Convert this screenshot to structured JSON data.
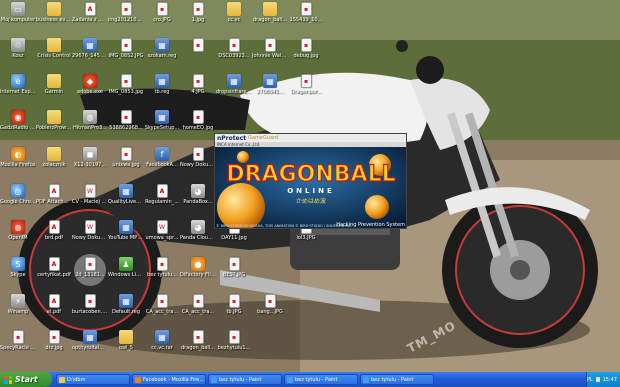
{
  "desktop": {
    "icons": [
      {
        "label": "Mój komputer",
        "kind": "gray",
        "glyph": "▭"
      },
      {
        "label": "business everywhere",
        "kind": "folder",
        "glyph": ""
      },
      {
        "label": "Zadania z matematyki",
        "kind": "pdf",
        "glyph": "A"
      },
      {
        "label": "img20121006...",
        "kind": "file",
        "glyph": "▪"
      },
      {
        "label": "cro.JPG",
        "kind": "file",
        "glyph": "▪"
      },
      {
        "label": "1.jpg",
        "kind": "file",
        "glyph": "▪"
      },
      {
        "label": "cc.vc",
        "kind": "folder",
        "glyph": ""
      },
      {
        "label": "dragon_ball...",
        "kind": "folder",
        "glyph": ""
      },
      {
        "label": "155439_10...",
        "kind": "file",
        "glyph": "▪"
      },
      {
        "label": "Kosz",
        "kind": "gray",
        "glyph": "♲"
      },
      {
        "label": "Crisis Control",
        "kind": "folder",
        "glyph": ""
      },
      {
        "label": "29676_14585...",
        "kind": "exe",
        "glyph": "▦"
      },
      {
        "label": "IMG_0852.JPG",
        "kind": "file",
        "glyph": "▪"
      },
      {
        "label": "szokam.reg",
        "kind": "exe",
        "glyph": "▦"
      },
      {
        "label": "",
        "kind": "file",
        "glyph": "▪"
      },
      {
        "label": "DSC03923...",
        "kind": "file",
        "glyph": "▪"
      },
      {
        "label": "Johnnie Walker office",
        "kind": "file",
        "glyph": "▪"
      },
      {
        "label": "debug.jpg",
        "kind": "file",
        "glyph": "▪"
      },
      {
        "label": "Internet Explorer",
        "kind": "globe",
        "glyph": "e"
      },
      {
        "label": "Garmin",
        "kind": "folder",
        "glyph": ""
      },
      {
        "label": "adobe.exe",
        "kind": "red",
        "glyph": "◆"
      },
      {
        "label": "IMG_0853.jpg",
        "kind": "file",
        "glyph": "▪"
      },
      {
        "label": "tb.reg",
        "kind": "exe",
        "glyph": "▦"
      },
      {
        "label": "4.JPG",
        "kind": "file",
        "glyph": "▪"
      },
      {
        "label": "dropsinfrared...",
        "kind": "exe",
        "glyph": "▦"
      },
      {
        "label": "2706041...",
        "kind": "exe",
        "glyph": "▦"
      },
      {
        "label": "Dragonpor...",
        "kind": "file",
        "glyph": "▪"
      },
      {
        "label": "GadziRadio 10",
        "kind": "red",
        "glyph": "◉"
      },
      {
        "label": "PobierzProwa...",
        "kind": "folder",
        "glyph": ""
      },
      {
        "label": "HitmanPro3...",
        "kind": "gray",
        "glyph": "◍"
      },
      {
        "label": "538862968...",
        "kind": "file",
        "glyph": "▪"
      },
      {
        "label": "SkypeSetup...",
        "kind": "exe",
        "glyph": "▦"
      },
      {
        "label": "homeEQ.jpg",
        "kind": "file",
        "glyph": "▪"
      },
      {
        "label": "Mozilla Firefox",
        "kind": "orange",
        "glyph": "◐"
      },
      {
        "label": "zolacznik",
        "kind": "folder",
        "glyph": ""
      },
      {
        "label": "X12-30197...",
        "kind": "gray",
        "glyph": "◼"
      },
      {
        "label": "unixwa.jpg",
        "kind": "file",
        "glyph": "▪"
      },
      {
        "label": "FacebookA...",
        "kind": "exe",
        "glyph": "f"
      },
      {
        "label": "Nowy Dokument",
        "kind": "file",
        "glyph": "▪"
      },
      {
        "label": "Google Chrome",
        "kind": "globe",
        "glyph": "◎"
      },
      {
        "label": "PDF Attachment",
        "kind": "pdf",
        "glyph": "A"
      },
      {
        "label": "CV - Maciej Cygan.doc",
        "kind": "file",
        "glyph": "W"
      },
      {
        "label": "QualityLiveH...",
        "kind": "exe",
        "glyph": "▦"
      },
      {
        "label": "Regulamin_...",
        "kind": "pdf",
        "glyph": "A"
      },
      {
        "label": "PandaBox...",
        "kind": "gray",
        "glyph": "◕"
      },
      {
        "label": "OpenIM",
        "kind": "red",
        "glyph": "◍"
      },
      {
        "label": "brd.pdf",
        "kind": "pdf",
        "glyph": "A"
      },
      {
        "label": "Nowy Dokument",
        "kind": "file",
        "glyph": "W"
      },
      {
        "label": "YouTube MP3 Converter",
        "kind": "exe",
        "glyph": "▦"
      },
      {
        "label": "umowa_spr...",
        "kind": "file",
        "glyph": "W"
      },
      {
        "label": "Panda Cloud Cleaner",
        "kind": "gray",
        "glyph": "◕"
      },
      {
        "label": "DAY11.jpg",
        "kind": "file",
        "glyph": "▪"
      },
      {
        "label": "lol3.JPG",
        "kind": "file",
        "glyph": "▪"
      },
      {
        "label": "Skype",
        "kind": "globe",
        "glyph": "S"
      },
      {
        "label": "certyfikat.pdf",
        "kind": "pdf",
        "glyph": "A"
      },
      {
        "label": "2d_13181...",
        "kind": "file",
        "glyph": "▪"
      },
      {
        "label": "Windows Live Messenger",
        "kind": "green",
        "glyph": "♟"
      },
      {
        "label": "bez tytulu...",
        "kind": "file",
        "glyph": "▪"
      },
      {
        "label": "DiFactory Flight...",
        "kind": "orange",
        "glyph": "●"
      },
      {
        "label": "BEST.JPG",
        "kind": "file",
        "glyph": "▪"
      },
      {
        "label": "Winamp",
        "kind": "gray",
        "glyph": "⚡"
      },
      {
        "label": "el.pdf",
        "kind": "pdf",
        "glyph": "A"
      },
      {
        "label": "burtacoben.jpg",
        "kind": "file",
        "glyph": "▪"
      },
      {
        "label": "Default.reg",
        "kind": "exe",
        "glyph": "▦"
      },
      {
        "label": "CA_acc_tra...",
        "kind": "file",
        "glyph": "▪"
      },
      {
        "label": "CA_acc_tra...",
        "kind": "file",
        "glyph": "▪"
      },
      {
        "label": "tb.JPG",
        "kind": "file",
        "glyph": "▪"
      },
      {
        "label": "bang...JPG",
        "kind": "file",
        "glyph": "▪"
      },
      {
        "label": "SpecyRacle technicznych",
        "kind": "file",
        "glyph": "▪"
      },
      {
        "label": "drz.jpg",
        "kind": "file",
        "glyph": "▪"
      },
      {
        "label": "opthyroitalwo...",
        "kind": "exe",
        "glyph": "▦"
      },
      {
        "label": "owl_5",
        "kind": "folder",
        "glyph": ""
      },
      {
        "label": "cc.vc.rar",
        "kind": "exe",
        "glyph": "▦"
      },
      {
        "label": "dragon_ball...",
        "kind": "file",
        "glyph": "▪"
      },
      {
        "label": "bezhytulu1...",
        "kind": "file",
        "glyph": "▪"
      }
    ]
  },
  "splash": {
    "brand": "nProtect",
    "brand_suffix": "GameGuard",
    "company": "INCA Internet Co.,Ltd.",
    "logo_title": "DRAGONBALL",
    "logo_sub": "ONLINE",
    "logo_tag": "かめはめ波",
    "footer_left": "© BIRD STUDIO/SHUEISHA, TOEI ANIMATION © BIRD STUDIO / SHUEISHA INC.",
    "footer_right": "Hacking Prevention System"
  },
  "watermark": "TM_MO",
  "taskbar": {
    "start_label": "Start",
    "items": [
      {
        "label": "D:\\dbm",
        "color": "#f1c94a"
      },
      {
        "label": "Facebook - Mozilla Fire...",
        "color": "#ff7a1a"
      },
      {
        "label": "bez tytulu - Paint",
        "color": "#4a9cf0"
      },
      {
        "label": "bez tytulu - Paint",
        "color": "#4a9cf0"
      },
      {
        "label": "bez tytulu - Paint",
        "color": "#4a9cf0"
      }
    ],
    "tray": {
      "lang": "PL",
      "time": "15:47"
    }
  },
  "colors": {
    "taskbar_blue": "#245fd6",
    "start_green": "#3a9a30",
    "tray_blue": "#0f7fd0"
  }
}
